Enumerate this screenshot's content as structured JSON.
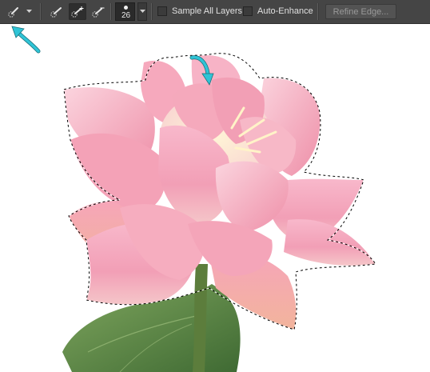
{
  "toolbar": {
    "brush_size": "26",
    "sample_all_layers_label": "Sample All Layers",
    "sample_all_layers_checked": false,
    "auto_enhance_label": "Auto-Enhance",
    "auto_enhance_checked": false,
    "refine_edge_label": "Refine Edge..."
  },
  "icons": {
    "tool_preset": "quick-selection-icon",
    "new_selection": "quick-selection-new-icon",
    "add_to_selection": "quick-selection-add-icon",
    "subtract_from_selection": "quick-selection-subtract-icon"
  },
  "colors": {
    "toolbar_bg": "#454545",
    "annotation_arrow": "#2fc4d6",
    "petal_pink": "#f2a3b8",
    "leaf_green": "#5f8a4a"
  }
}
